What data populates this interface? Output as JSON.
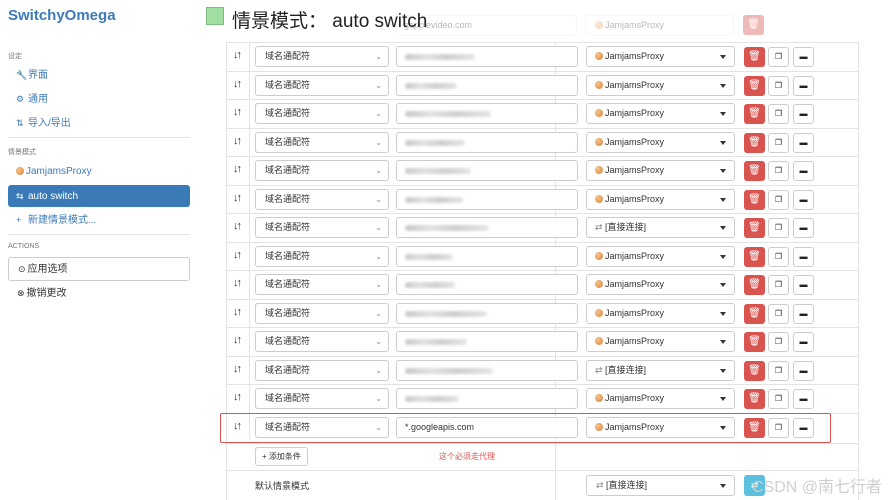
{
  "app": {
    "name": "SwitchyOmega"
  },
  "sidebar": {
    "settings_header": "设定",
    "settings_items": [
      {
        "icon": "wrench-icon",
        "glyph": "🔧",
        "label": "界面"
      },
      {
        "icon": "gear-icon",
        "glyph": "⚙",
        "label": "通用"
      },
      {
        "icon": "import-export-icon",
        "glyph": "⇅",
        "label": "导入/导出"
      }
    ],
    "profiles_header": "情景模式",
    "profiles": [
      {
        "icon": "globe-icon",
        "label": "JamjamsProxy",
        "active": false
      },
      {
        "icon": "switch-icon",
        "glyph": "⇆",
        "label": "auto switch",
        "active": true
      }
    ],
    "new_profile": {
      "glyph": "+",
      "label": "新建情景模式..."
    },
    "actions_header": "ACTIONS",
    "apply": {
      "glyph": "⊙",
      "label": "应用选项"
    },
    "discard": {
      "glyph": "⊗",
      "label": "撤销更改"
    }
  },
  "header": {
    "title": "情景模式：  auto switch",
    "color": "#9fe0a0"
  },
  "ghost_row": {
    "pattern": "gapplevideo.com",
    "profile": "JamjamsProxy"
  },
  "rules": [
    {
      "condition": "域名通配符",
      "pattern": "",
      "profile": "JamjamsProxy",
      "profile_icon": "globe-icon"
    },
    {
      "condition": "域名通配符",
      "pattern": "",
      "profile": "JamjamsProxy",
      "profile_icon": "globe-icon"
    },
    {
      "condition": "域名通配符",
      "pattern": "",
      "profile": "JamjamsProxy",
      "profile_icon": "globe-icon"
    },
    {
      "condition": "域名通配符",
      "pattern": "",
      "profile": "JamjamsProxy",
      "profile_icon": "globe-icon"
    },
    {
      "condition": "域名通配符",
      "pattern": "",
      "profile": "JamjamsProxy",
      "profile_icon": "globe-icon"
    },
    {
      "condition": "域名通配符",
      "pattern": "",
      "profile": "JamjamsProxy",
      "profile_icon": "globe-icon"
    },
    {
      "condition": "域名通配符",
      "pattern": "",
      "profile": "[直接连接]",
      "profile_icon": "direct-icon"
    },
    {
      "condition": "域名通配符",
      "pattern": "",
      "profile": "JamjamsProxy",
      "profile_icon": "globe-icon"
    },
    {
      "condition": "域名通配符",
      "pattern": "",
      "profile": "JamjamsProxy",
      "profile_icon": "globe-icon"
    },
    {
      "condition": "域名通配符",
      "pattern": "",
      "profile": "JamjamsProxy",
      "profile_icon": "globe-icon"
    },
    {
      "condition": "域名通配符",
      "pattern": "",
      "profile": "JamjamsProxy",
      "profile_icon": "globe-icon"
    },
    {
      "condition": "域名通配符",
      "pattern": "",
      "profile": "[直接连接]",
      "profile_icon": "direct-icon"
    },
    {
      "condition": "域名通配符",
      "pattern": "",
      "profile": "JamjamsProxy",
      "profile_icon": "globe-icon"
    },
    {
      "condition": "域名通配符",
      "pattern": "*.googleapis.com",
      "profile": "JamjamsProxy",
      "profile_icon": "globe-icon",
      "highlighted": true
    }
  ],
  "add_condition": {
    "glyph": "+",
    "label": "添加条件"
  },
  "annotation": "这个必须走代理",
  "default_row": {
    "label": "默认情景模式",
    "profile": "[直接连接]",
    "direct_glyph": "⇄"
  },
  "watermark": "CSDN @南七行者",
  "colors": {
    "accent": "#3a7ab7",
    "danger": "#d9534f",
    "info": "#5bc0de"
  }
}
